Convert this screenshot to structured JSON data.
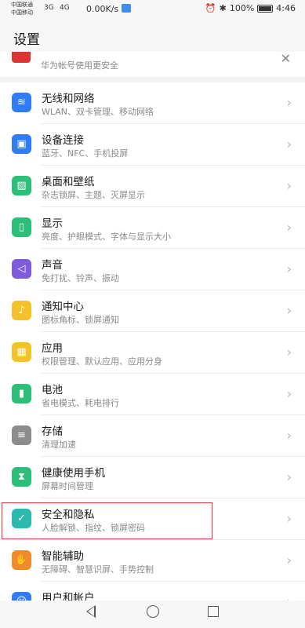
{
  "status": {
    "carrier1": "中国联通",
    "carrier2": "中国移动",
    "sig1": "3G",
    "sig2": "4G",
    "speed": "0.00K/s",
    "battery": "100%",
    "time": "4:46"
  },
  "header": {
    "title": "设置"
  },
  "account": {
    "subtitle": "华为帐号使用更安全"
  },
  "items": [
    {
      "label": "无线和网络",
      "sub": "WLAN、双卡管理、移动网络",
      "color": "#2f7cf6",
      "icon": "wifi-icon"
    },
    {
      "label": "设备连接",
      "sub": "蓝牙、NFC、手机投屏",
      "color": "#2f7cf6",
      "icon": "device-connect-icon"
    },
    {
      "label": "桌面和壁纸",
      "sub": "杂志锁屏、主题、灭屏显示",
      "color": "#2cbf78",
      "icon": "wallpaper-icon"
    },
    {
      "label": "显示",
      "sub": "亮度、护眼模式、字体与显示大小",
      "color": "#2cbf78",
      "icon": "display-icon"
    },
    {
      "label": "声音",
      "sub": "免打扰、铃声、振动",
      "color": "#7d5bdc",
      "icon": "sound-icon"
    },
    {
      "label": "通知中心",
      "sub": "图标角标、锁屏通知",
      "color": "#f3c22a",
      "icon": "bell-icon"
    },
    {
      "label": "应用",
      "sub": "权限管理、默认应用、应用分身",
      "color": "#f3c22a",
      "icon": "apps-icon"
    },
    {
      "label": "电池",
      "sub": "省电模式、耗电排行",
      "color": "#2cbf78",
      "icon": "battery-icon"
    },
    {
      "label": "存储",
      "sub": "清理加速",
      "color": "#8c8c8c",
      "icon": "storage-icon"
    },
    {
      "label": "健康使用手机",
      "sub": "屏幕时间管理",
      "color": "#2cbf78",
      "icon": "hourglass-icon"
    },
    {
      "label": "安全和隐私",
      "sub": "人脸解锁、指纹、锁屏密码",
      "color": "#2bb9b0",
      "icon": "shield-icon"
    },
    {
      "label": "智能辅助",
      "sub": "无障碍、智慧识屏、手势控制",
      "color": "#f08a2c",
      "icon": "hand-icon"
    },
    {
      "label": "用户和帐户",
      "sub": "",
      "color": "#2f7cf6",
      "icon": "user-icon"
    }
  ]
}
